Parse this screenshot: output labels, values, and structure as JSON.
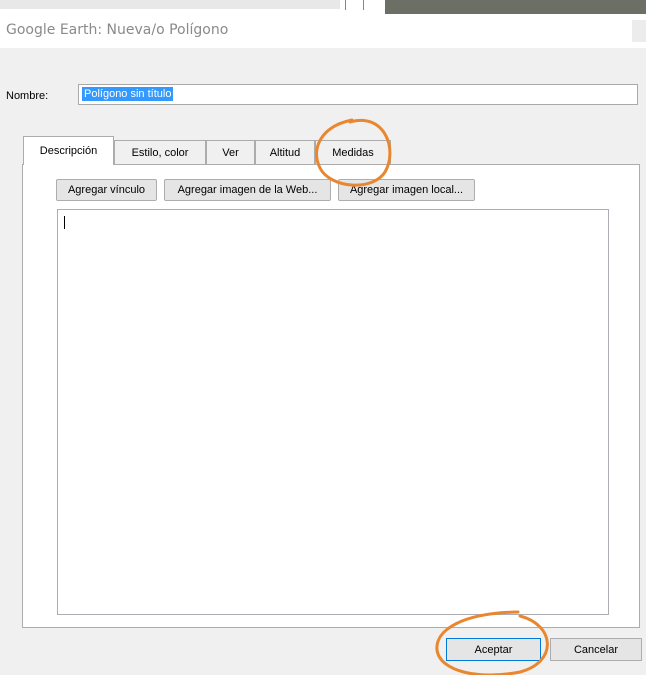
{
  "window": {
    "title": "Google Earth: Nueva/o Polígono"
  },
  "name_field": {
    "label": "Nombre:",
    "value": "Polígono sin título"
  },
  "tabs": [
    {
      "label": "Descripción",
      "active": true
    },
    {
      "label": "Estilo, color",
      "active": false
    },
    {
      "label": "Ver",
      "active": false
    },
    {
      "label": "Altitud",
      "active": false
    },
    {
      "label": "Medidas",
      "active": false
    }
  ],
  "description_toolbar": {
    "add_link": "Agregar vínculo",
    "add_web_image": "Agregar imagen de la Web...",
    "add_local_image": "Agregar imagen local..."
  },
  "description_text": "",
  "footer": {
    "ok": "Aceptar",
    "cancel": "Cancelar"
  },
  "colors": {
    "highlight": "#3399ff",
    "annotation": "#e8872f",
    "dialog_bg": "#f0f0f0"
  }
}
